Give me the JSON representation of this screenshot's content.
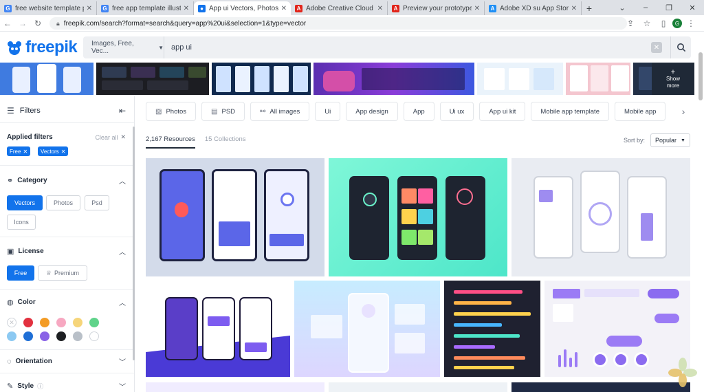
{
  "browser": {
    "tabs": [
      {
        "title": "free website template phot",
        "favicon": "G",
        "color": "#4285f4"
      },
      {
        "title": "free app template illustrati",
        "favicon": "G",
        "color": "#4285f4"
      },
      {
        "title": "App ui Vectors, Photos and",
        "favicon": "fp",
        "color": "#1273eb"
      },
      {
        "title": "Adobe Creative Cloud | Dis",
        "favicon": "A",
        "color": "#e1251b"
      },
      {
        "title": "Preview your prototypes or",
        "favicon": "A",
        "color": "#e1251b"
      },
      {
        "title": "Adobe XD su App Store",
        "favicon": "A",
        "color": "#1f8ff5"
      }
    ],
    "url": "freepik.com/search?format=search&query=app%20ui&selection=1&type=vector",
    "profile_initial": "G"
  },
  "header": {
    "logo": "freepik",
    "search_type": "Images, Free, Vec...",
    "search_value": "app ui"
  },
  "strip": {
    "show_more": "Show more"
  },
  "sidebar": {
    "filters_title": "Filters",
    "applied_title": "Applied filters",
    "clear_all": "Clear all",
    "applied": [
      "Free",
      "Vectors"
    ],
    "category_title": "Category",
    "categories": [
      "Vectors",
      "Photos",
      "Psd",
      "Icons"
    ],
    "license_title": "License",
    "licenses": [
      "Free",
      "Premium"
    ],
    "color_title": "Color",
    "orientation_title": "Orientation",
    "style_title": "Style"
  },
  "main": {
    "tags": [
      "Photos",
      "PSD",
      "All images",
      "Ui",
      "App design",
      "App",
      "Ui ux",
      "App ui kit",
      "Mobile app template",
      "Mobile app"
    ],
    "resources": "2,167 Resources",
    "collections": "15 Collections",
    "sort_label": "Sort by:",
    "sort_value": "Popular"
  },
  "colors": {
    "brand": "#1273eb",
    "swatches": [
      "#e2313f",
      "#f39c26",
      "#f7a8c1",
      "#f6d57a",
      "#5fd38a",
      "#8cc9f2",
      "#1f6fd6",
      "#8a63e6",
      "#1d1f22",
      "#b9c0c8",
      "#ffffff"
    ]
  }
}
